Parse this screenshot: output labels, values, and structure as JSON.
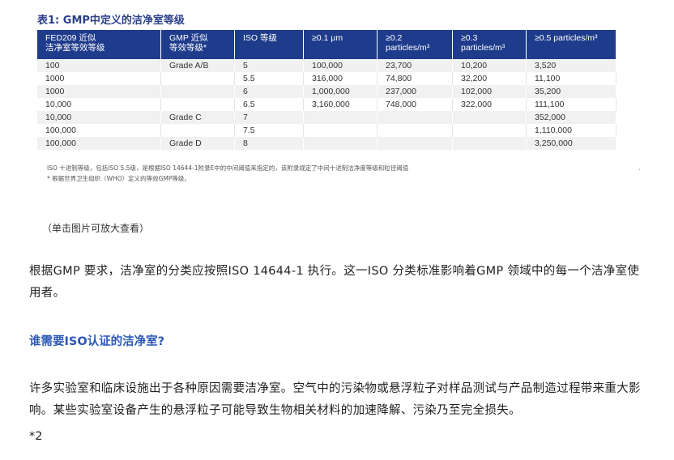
{
  "figure": {
    "title": "表1: GMP中定义的洁净室等级",
    "headers": [
      "FED209 近似\n洁净室等效等级",
      "GMP 近似\n等效等级*",
      "ISO 等级",
      "≥0.1 μm",
      "≥0.2 particles/m³",
      "≥0.3 particles/m³",
      "≥0.5 particles/m³"
    ],
    "rows": [
      [
        "100",
        "Grade A/B",
        "5",
        "100,000",
        "23,700",
        "10,200",
        "3,520"
      ],
      [
        "1000",
        "",
        "5.5",
        "316,000",
        "74,800",
        "32,200",
        "11,100"
      ],
      [
        "1000",
        "",
        "6",
        "1,000,000",
        "237,000",
        "102,000",
        "35,200"
      ],
      [
        "10,000",
        "",
        "6.5",
        "3,160,000",
        "748,000",
        "322,000",
        "111,100"
      ],
      [
        "10,000",
        "Grade C",
        "7",
        "",
        "",
        "",
        "352,000"
      ],
      [
        "100,000",
        "",
        "7.5",
        "",
        "",
        "",
        "1,110,000"
      ],
      [
        "100,000",
        "Grade D",
        "8",
        "",
        "",
        "",
        "3,250,000"
      ]
    ],
    "note1": "ISO 十进制等级，包括ISO 5.5级，是根据ISO 14644-1附录E中的中间阈值来指定的，该附录规定了中间十进制洁净度等级和粒径阈值",
    "note2": "* 根据世界卫生组织（WHO）定义的等效GMP等级。",
    "dot": "."
  },
  "caption": "（单击图片可放大查看）",
  "paragraph1": "根据GMP 要求，洁净室的分类应按照ISO 14644-1 执行。这一ISO 分类标准影响着GMP 领域中的每一个洁净室使用者。",
  "heading": "谁需要ISO认证的洁净室?",
  "paragraph2": "许多实验室和临床设施出于各种原因需要洁净室。空气中的污染物或悬浮粒子对样品测试与产品制造过程带来重大影响。某些实验室设备产生的悬浮粒子可能导致生物相关材料的加速降解、污染乃至完全损失。",
  "footnote": "*2"
}
